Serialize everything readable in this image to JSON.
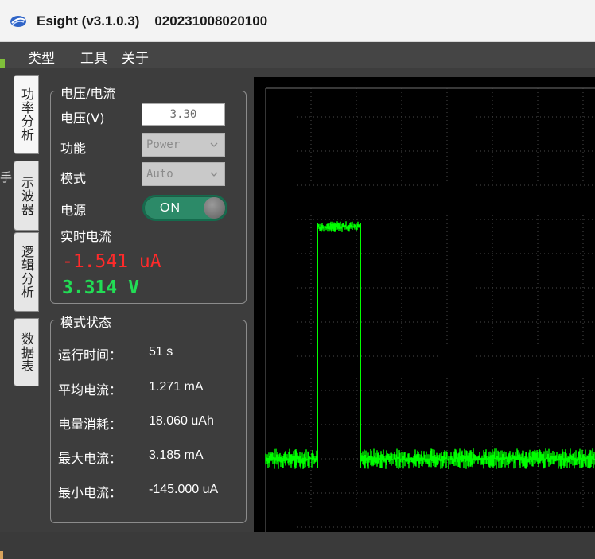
{
  "window": {
    "title": "Esight (v3.1.0.3)",
    "serial": "020231008020100",
    "icon": "esight-logo-icon"
  },
  "menu": [
    {
      "label": "类型"
    },
    {
      "label": "工具"
    },
    {
      "label": "关于"
    }
  ],
  "edge_text": "手",
  "tabs": [
    {
      "label": "功率分析",
      "active": true
    },
    {
      "label": "示波器",
      "active": false
    },
    {
      "label": "逻辑分析",
      "active": false
    },
    {
      "label": "数据表",
      "active": false
    }
  ],
  "power_group": {
    "title": "电压/电流",
    "voltage_label": "电压(V)",
    "voltage_value": "3.30",
    "function_label": "功能",
    "function_value": "Power",
    "mode_label": "模式",
    "mode_value": "Auto",
    "power_label": "电源",
    "power_state": "ON",
    "realtime_label": "实时电流",
    "current_reading": "-1.541 uA",
    "voltage_reading": "3.314 V",
    "colors": {
      "current": "#ff2a2a",
      "voltage": "#22dd55",
      "toggle": "#2c8a68"
    }
  },
  "status_group": {
    "title": "模式状态",
    "rows": [
      {
        "label": "运行时间：",
        "value": "51 s"
      },
      {
        "label": "平均电流：",
        "value": "1.271 mA"
      },
      {
        "label": "电量消耗：",
        "value": "18.060 uAh"
      },
      {
        "label": "最大电流：",
        "value": "3.185 mA"
      },
      {
        "label": "最小电流：",
        "value": "-145.000 uA"
      }
    ]
  },
  "scope": {
    "trace_color": "#00ff00",
    "background": "#000000"
  }
}
